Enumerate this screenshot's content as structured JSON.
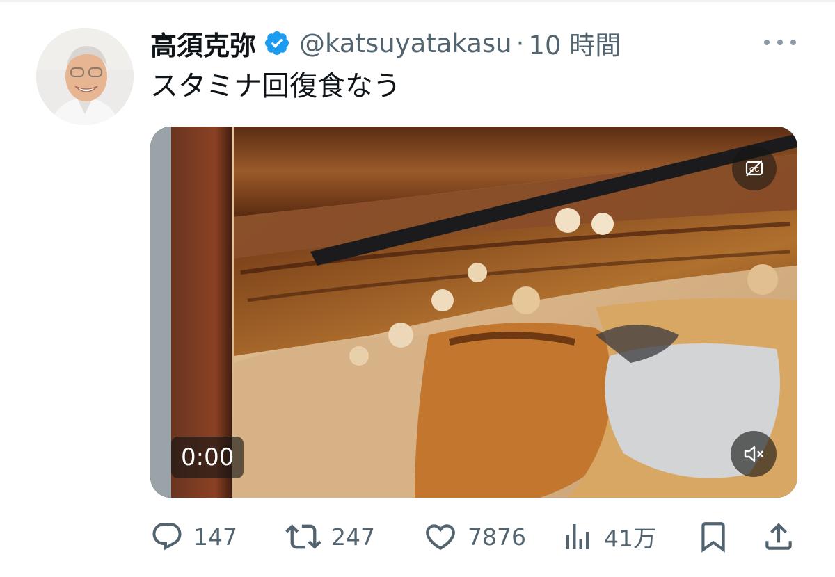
{
  "tweet": {
    "display_name": "高須克弥",
    "handle": "@katsuyatakasu",
    "separator": "·",
    "time": "10 時間",
    "text": "スタミナ回復食なう",
    "verified": true
  },
  "media": {
    "timestamp": "0:00",
    "cc_icon": "captions-off-icon",
    "mute_icon": "volume-muted-icon"
  },
  "actions": {
    "replies": "147",
    "retweets": "247",
    "likes": "7876",
    "views": "41万"
  },
  "colors": {
    "text": "#0f1419",
    "secondary": "#536471",
    "verified": "#1d9bf0"
  }
}
